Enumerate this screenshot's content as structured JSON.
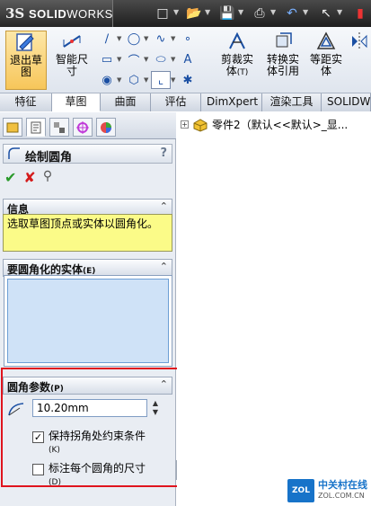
{
  "titlebar": {
    "logo_ds": "3S",
    "logo_brand_bold": "SOLID",
    "logo_brand": "WORKS"
  },
  "ribbon": {
    "exit_sketch": "退出草图",
    "smart_dimension": "智能尺寸",
    "trim": "剪裁实体",
    "trim_hotkey": "(T)",
    "convert": "转换实体引用",
    "offset": "等距实体"
  },
  "tabs": [
    "特征",
    "草图",
    "曲面",
    "评估",
    "DimXpert",
    "渲染工具",
    "SOLIDWO"
  ],
  "active_tab": "草图",
  "property_manager": {
    "title": "绘制圆角",
    "help": "?",
    "info_group": "信息",
    "info_text": "选取草图顶点或实体以圆角化。",
    "entities_group": "要圆角化的实体",
    "entities_hotkey": "(E)",
    "params_group": "圆角参数",
    "params_hotkey": "(P)",
    "radius_value": "10.20mm",
    "keep_constraints_label": "保持拐角处约束条件",
    "keep_constraints_hotkey": "(K)",
    "keep_constraints_checked": true,
    "dimension_each_label": "标注每个圆角的尺寸",
    "dimension_each_hotkey": "(D)",
    "dimension_each_checked": false
  },
  "tree": {
    "part_label": "零件2（默认<<默认>_显..."
  },
  "watermark": {
    "icon_text": "ZOL",
    "name": "中关村在线",
    "site": "ZOL.COM.CN"
  },
  "colors": {
    "highlight_box": "#e0141e",
    "info_bg": "#fbfb88",
    "ok_green": "#2a9a2a",
    "cancel_red": "#d41b1b"
  }
}
